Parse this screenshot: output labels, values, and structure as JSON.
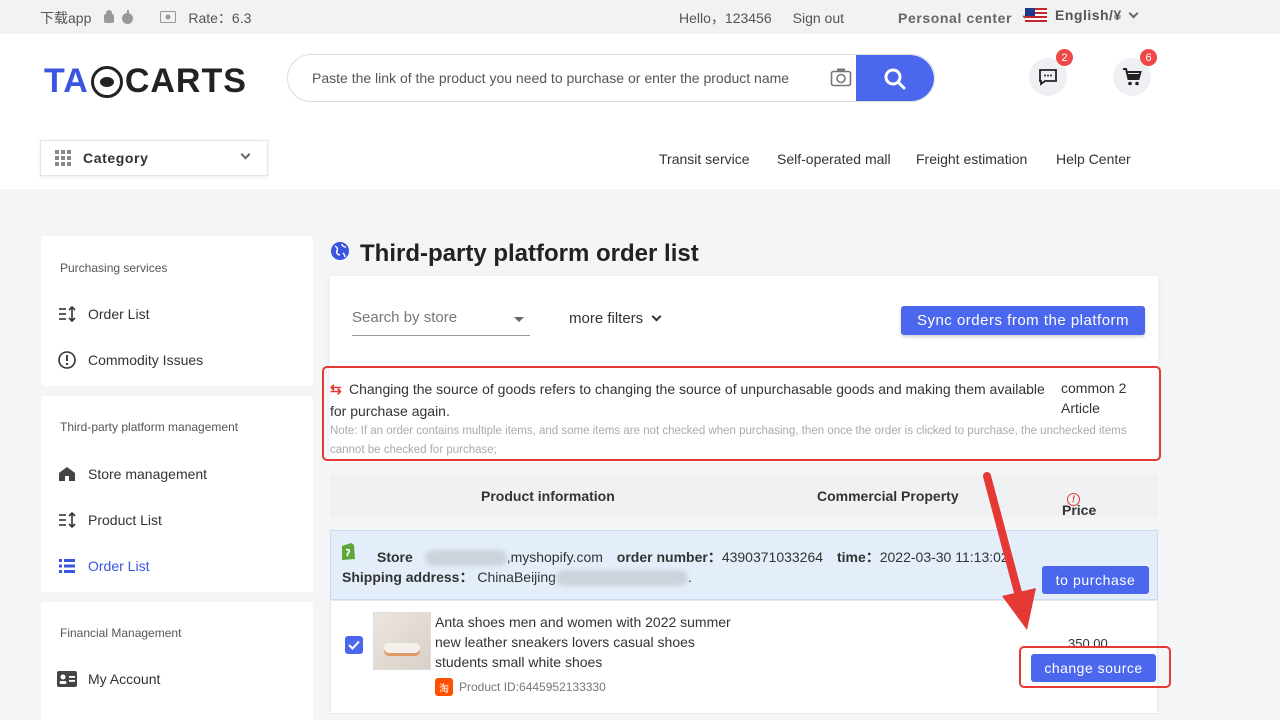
{
  "topbar": {
    "download_app": "下载app",
    "rate": "Rate：6.3",
    "greeting": "Hello，123456",
    "sign_out": "Sign out",
    "personal_center": "Personal center",
    "language": "English/¥"
  },
  "header": {
    "logo_left": "TA",
    "logo_right": "CARTS",
    "search_placeholder": "Paste the link of the product you need to purchase or enter the product name",
    "messages_count": "2",
    "cart_count": "6",
    "category_label": "Category",
    "nav": [
      "Transit service",
      "Self-operated mall",
      "Freight estimation",
      "Help Center"
    ]
  },
  "sidebar": {
    "sections": [
      {
        "title": "Purchasing services",
        "items": [
          "Order List",
          "Commodity Issues"
        ]
      },
      {
        "title": "Third-party platform management",
        "items": [
          "Store management",
          "Product List",
          "Order List"
        ]
      },
      {
        "title": "Financial Management",
        "items": [
          "My Account"
        ]
      }
    ],
    "active_item": "Order List"
  },
  "main": {
    "title": "Third-party platform order list",
    "store_select_placeholder": "Search by store",
    "more_filters": "more filters",
    "sync_button": "Sync orders from the platform",
    "notice_text": "Changing the source of goods refers to changing the source of unpurchasable goods and making them available for purchase again.",
    "notice_count": "common 2 Article",
    "notice_note": "Note: If an order contains multiple items, and some items are not checked when purchasing, then once the order is clicked to purchase, the unchecked items cannot be checked for purchase;",
    "columns": [
      "Product information",
      "Commercial Property",
      "Price"
    ],
    "order": {
      "store_label": "Store",
      "store_domain": ",myshopify.com",
      "order_number_label": "order number：",
      "order_number": "4390371033264",
      "time_label": "time：",
      "time": "2022-03-30 11:13:02",
      "shipping_label": "Shipping address：",
      "shipping_value": "ChinaBeijing",
      "end_dot": ".",
      "purchase_button": "to purchase"
    },
    "product": {
      "name": "Anta shoes men and women with 2022 summer new leather sneakers lovers casual shoes students small white shoes",
      "id_text": "Product ID:6445952133330",
      "platform_badge": "淘",
      "price": "350.00",
      "change_source_button": "change source",
      "checked": true
    }
  },
  "colors": {
    "accent": "#4a67ee",
    "highlight": "#e53935"
  }
}
